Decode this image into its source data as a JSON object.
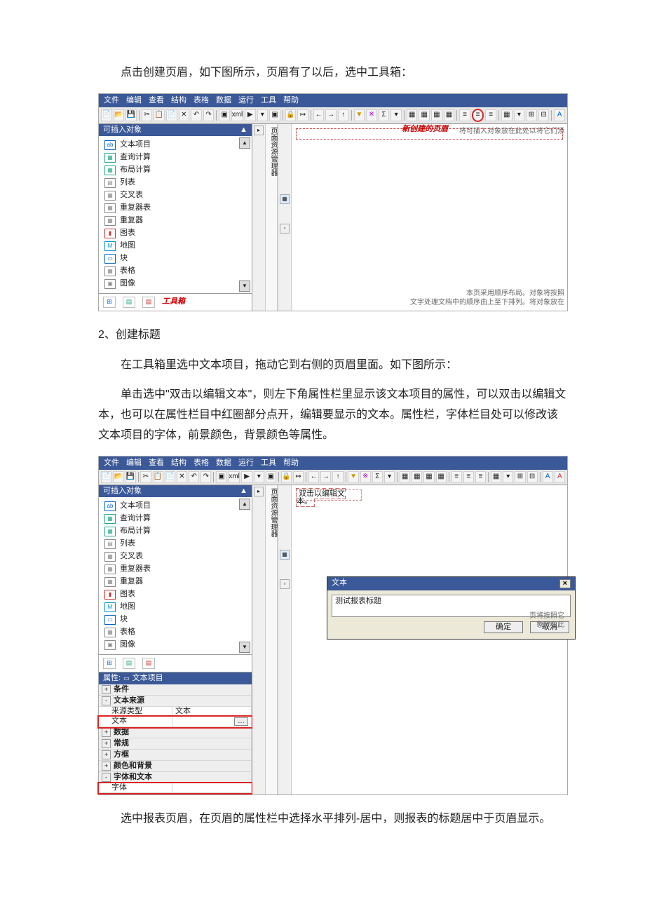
{
  "doc": {
    "p1": "点击创建页眉，如下图所示，页眉有了以后，选中工具箱：",
    "p2": "2、创建标题",
    "p3": "在工具箱里选中文本项目，拖动它到右侧的页眉里面。如下图所示：",
    "p4": "单击选中\"双击以编辑文本\"，则左下角属性栏里显示该文本项目的属性，可以双击以编辑文本，也可以在属性栏目中红圈部分点开，编辑要显示的文本。属性栏，字体栏目处可以修改该文本项目的字体，前景颜色，背景颜色等属性。",
    "p5": "选中报表页眉，在页眉的属性栏中选择水平排列-居中，则报表的标题居中于页眉显示。"
  },
  "menus": [
    "文件",
    "编辑",
    "查看",
    "结构",
    "表格",
    "数据",
    "运行",
    "工具",
    "帮助"
  ],
  "panel_title": "可插入对象",
  "insertables": [
    "文本项目",
    "查询计算",
    "布局计算",
    "列表",
    "交叉表",
    "重复器表",
    "重复器",
    "图表",
    "地图",
    "块",
    "表格",
    "图像"
  ],
  "toolbox_label": "工具箱",
  "header_label": "新创建的页眉",
  "canvas_hints": {
    "top_right": "将可插入对象放在此处以将它们添",
    "bottom_r1": "本页采用顺序布局。对象将按照",
    "bottom_r2": "文字处理文档中的顺序由上至下排列。将对象放在"
  },
  "midstrip_label": "页面资源管理器",
  "edit_placeholder": "双击以编辑文本。",
  "dialog": {
    "title": "文本",
    "value": "测试报表标题",
    "ok": "确定",
    "cancel": "取消"
  },
  "prop": {
    "title_prefix": "属性:",
    "title_obj": "文本项目",
    "rows": [
      {
        "type": "group",
        "label": "条件",
        "plus": "+"
      },
      {
        "type": "group",
        "label": "文本来源",
        "plus": "-"
      },
      {
        "type": "kv",
        "k": "来源类型",
        "v": "文本",
        "indent": true
      },
      {
        "type": "kv",
        "k": "文本",
        "v": "",
        "indent": true,
        "red": true,
        "btn": true
      },
      {
        "type": "group",
        "label": "数据",
        "plus": "+"
      },
      {
        "type": "group",
        "label": "常规",
        "plus": "+"
      },
      {
        "type": "group",
        "label": "方框",
        "plus": "+"
      },
      {
        "type": "group",
        "label": "颜色和背景",
        "plus": "+"
      },
      {
        "type": "group",
        "label": "字体和文本",
        "plus": "-"
      },
      {
        "type": "kv",
        "k": "字体",
        "v": "",
        "indent": true,
        "red": true
      }
    ]
  },
  "toolbar_icons": [
    {
      "g": "📄",
      "n": "new-file-icon"
    },
    {
      "g": "📂",
      "n": "open-icon"
    },
    {
      "g": "💾",
      "n": "save-icon"
    },
    {
      "sep": true
    },
    {
      "g": "✂",
      "n": "cut-icon"
    },
    {
      "g": "📋",
      "n": "copy-icon"
    },
    {
      "g": "📄",
      "n": "paste-icon"
    },
    {
      "g": "✕",
      "n": "delete-icon"
    },
    {
      "g": "↶",
      "n": "undo-icon"
    },
    {
      "g": "↷",
      "n": "redo-icon"
    },
    {
      "sep": true
    },
    {
      "g": "▣",
      "n": "validate-icon"
    },
    {
      "g": "xml",
      "n": "xml-icon"
    },
    {
      "g": "▶",
      "n": "run-icon"
    },
    {
      "g": "▾",
      "n": "run-drop-icon"
    },
    {
      "g": "▣",
      "n": "page-icon"
    },
    {
      "sep": true
    },
    {
      "g": "🔒",
      "n": "lock-icon"
    },
    {
      "g": "↦",
      "n": "goto-icon"
    },
    {
      "sep": true
    },
    {
      "g": "←",
      "n": "back-icon"
    },
    {
      "g": "→",
      "n": "fwd-icon"
    },
    {
      "g": "↑",
      "n": "up-icon"
    },
    {
      "sep": true
    },
    {
      "g": "▼",
      "n": "filter-icon",
      "c": "#c90"
    },
    {
      "g": "※",
      "n": "sort-icon",
      "c": "#a0f"
    },
    {
      "g": "Σ",
      "n": "sum-icon"
    },
    {
      "g": "▾",
      "n": "sum-drop"
    },
    {
      "sep": true
    },
    {
      "g": "▦",
      "n": "header-icon"
    },
    {
      "g": "▦",
      "n": "body-icon"
    },
    {
      "g": "▦",
      "n": "footer-icon1"
    },
    {
      "g": "▦",
      "n": "footer-icon2"
    },
    {
      "sep": true
    },
    {
      "g": "≡",
      "n": "header-create-icon"
    },
    {
      "g": "≡",
      "n": "header-create-icon-2",
      "circled": true
    },
    {
      "g": "≡",
      "n": "footer-create-icon"
    },
    {
      "sep": true
    },
    {
      "g": "▦",
      "n": "table-icon"
    },
    {
      "g": "▾",
      "n": "tab-drop"
    },
    {
      "g": "⊞",
      "n": "cell-merge-icon"
    },
    {
      "g": "⊟",
      "n": "cell-split-icon"
    },
    {
      "sep": true
    },
    {
      "g": "A",
      "n": "font-icon",
      "c": "#06c"
    }
  ],
  "legend_colors": {
    "q": "#2a8",
    "layout": "#2a8",
    "list": "#888",
    "cross": "#888",
    "rep": "#888",
    "chart": "#c33",
    "map": "#09c",
    "block": "#06c",
    "img": "#888"
  },
  "side_far_hint1": "页将按照它",
  "side_far_hint2": "象放在此"
}
